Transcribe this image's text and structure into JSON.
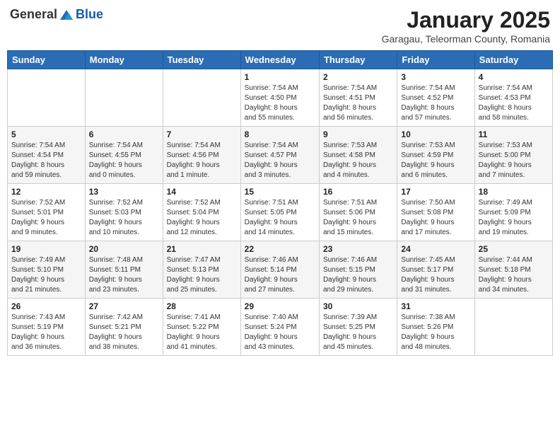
{
  "header": {
    "logo_general": "General",
    "logo_blue": "Blue",
    "month": "January 2025",
    "location": "Garagau, Teleorman County, Romania"
  },
  "days_of_week": [
    "Sunday",
    "Monday",
    "Tuesday",
    "Wednesday",
    "Thursday",
    "Friday",
    "Saturday"
  ],
  "weeks": [
    [
      {
        "day": "",
        "info": ""
      },
      {
        "day": "",
        "info": ""
      },
      {
        "day": "",
        "info": ""
      },
      {
        "day": "1",
        "info": "Sunrise: 7:54 AM\nSunset: 4:50 PM\nDaylight: 8 hours\nand 55 minutes."
      },
      {
        "day": "2",
        "info": "Sunrise: 7:54 AM\nSunset: 4:51 PM\nDaylight: 8 hours\nand 56 minutes."
      },
      {
        "day": "3",
        "info": "Sunrise: 7:54 AM\nSunset: 4:52 PM\nDaylight: 8 hours\nand 57 minutes."
      },
      {
        "day": "4",
        "info": "Sunrise: 7:54 AM\nSunset: 4:53 PM\nDaylight: 8 hours\nand 58 minutes."
      }
    ],
    [
      {
        "day": "5",
        "info": "Sunrise: 7:54 AM\nSunset: 4:54 PM\nDaylight: 8 hours\nand 59 minutes."
      },
      {
        "day": "6",
        "info": "Sunrise: 7:54 AM\nSunset: 4:55 PM\nDaylight: 9 hours\nand 0 minutes."
      },
      {
        "day": "7",
        "info": "Sunrise: 7:54 AM\nSunset: 4:56 PM\nDaylight: 9 hours\nand 1 minute."
      },
      {
        "day": "8",
        "info": "Sunrise: 7:54 AM\nSunset: 4:57 PM\nDaylight: 9 hours\nand 3 minutes."
      },
      {
        "day": "9",
        "info": "Sunrise: 7:53 AM\nSunset: 4:58 PM\nDaylight: 9 hours\nand 4 minutes."
      },
      {
        "day": "10",
        "info": "Sunrise: 7:53 AM\nSunset: 4:59 PM\nDaylight: 9 hours\nand 6 minutes."
      },
      {
        "day": "11",
        "info": "Sunrise: 7:53 AM\nSunset: 5:00 PM\nDaylight: 9 hours\nand 7 minutes."
      }
    ],
    [
      {
        "day": "12",
        "info": "Sunrise: 7:52 AM\nSunset: 5:01 PM\nDaylight: 9 hours\nand 9 minutes."
      },
      {
        "day": "13",
        "info": "Sunrise: 7:52 AM\nSunset: 5:03 PM\nDaylight: 9 hours\nand 10 minutes."
      },
      {
        "day": "14",
        "info": "Sunrise: 7:52 AM\nSunset: 5:04 PM\nDaylight: 9 hours\nand 12 minutes."
      },
      {
        "day": "15",
        "info": "Sunrise: 7:51 AM\nSunset: 5:05 PM\nDaylight: 9 hours\nand 14 minutes."
      },
      {
        "day": "16",
        "info": "Sunrise: 7:51 AM\nSunset: 5:06 PM\nDaylight: 9 hours\nand 15 minutes."
      },
      {
        "day": "17",
        "info": "Sunrise: 7:50 AM\nSunset: 5:08 PM\nDaylight: 9 hours\nand 17 minutes."
      },
      {
        "day": "18",
        "info": "Sunrise: 7:49 AM\nSunset: 5:09 PM\nDaylight: 9 hours\nand 19 minutes."
      }
    ],
    [
      {
        "day": "19",
        "info": "Sunrise: 7:49 AM\nSunset: 5:10 PM\nDaylight: 9 hours\nand 21 minutes."
      },
      {
        "day": "20",
        "info": "Sunrise: 7:48 AM\nSunset: 5:11 PM\nDaylight: 9 hours\nand 23 minutes."
      },
      {
        "day": "21",
        "info": "Sunrise: 7:47 AM\nSunset: 5:13 PM\nDaylight: 9 hours\nand 25 minutes."
      },
      {
        "day": "22",
        "info": "Sunrise: 7:46 AM\nSunset: 5:14 PM\nDaylight: 9 hours\nand 27 minutes."
      },
      {
        "day": "23",
        "info": "Sunrise: 7:46 AM\nSunset: 5:15 PM\nDaylight: 9 hours\nand 29 minutes."
      },
      {
        "day": "24",
        "info": "Sunrise: 7:45 AM\nSunset: 5:17 PM\nDaylight: 9 hours\nand 31 minutes."
      },
      {
        "day": "25",
        "info": "Sunrise: 7:44 AM\nSunset: 5:18 PM\nDaylight: 9 hours\nand 34 minutes."
      }
    ],
    [
      {
        "day": "26",
        "info": "Sunrise: 7:43 AM\nSunset: 5:19 PM\nDaylight: 9 hours\nand 36 minutes."
      },
      {
        "day": "27",
        "info": "Sunrise: 7:42 AM\nSunset: 5:21 PM\nDaylight: 9 hours\nand 38 minutes."
      },
      {
        "day": "28",
        "info": "Sunrise: 7:41 AM\nSunset: 5:22 PM\nDaylight: 9 hours\nand 41 minutes."
      },
      {
        "day": "29",
        "info": "Sunrise: 7:40 AM\nSunset: 5:24 PM\nDaylight: 9 hours\nand 43 minutes."
      },
      {
        "day": "30",
        "info": "Sunrise: 7:39 AM\nSunset: 5:25 PM\nDaylight: 9 hours\nand 45 minutes."
      },
      {
        "day": "31",
        "info": "Sunrise: 7:38 AM\nSunset: 5:26 PM\nDaylight: 9 hours\nand 48 minutes."
      },
      {
        "day": "",
        "info": ""
      }
    ]
  ]
}
